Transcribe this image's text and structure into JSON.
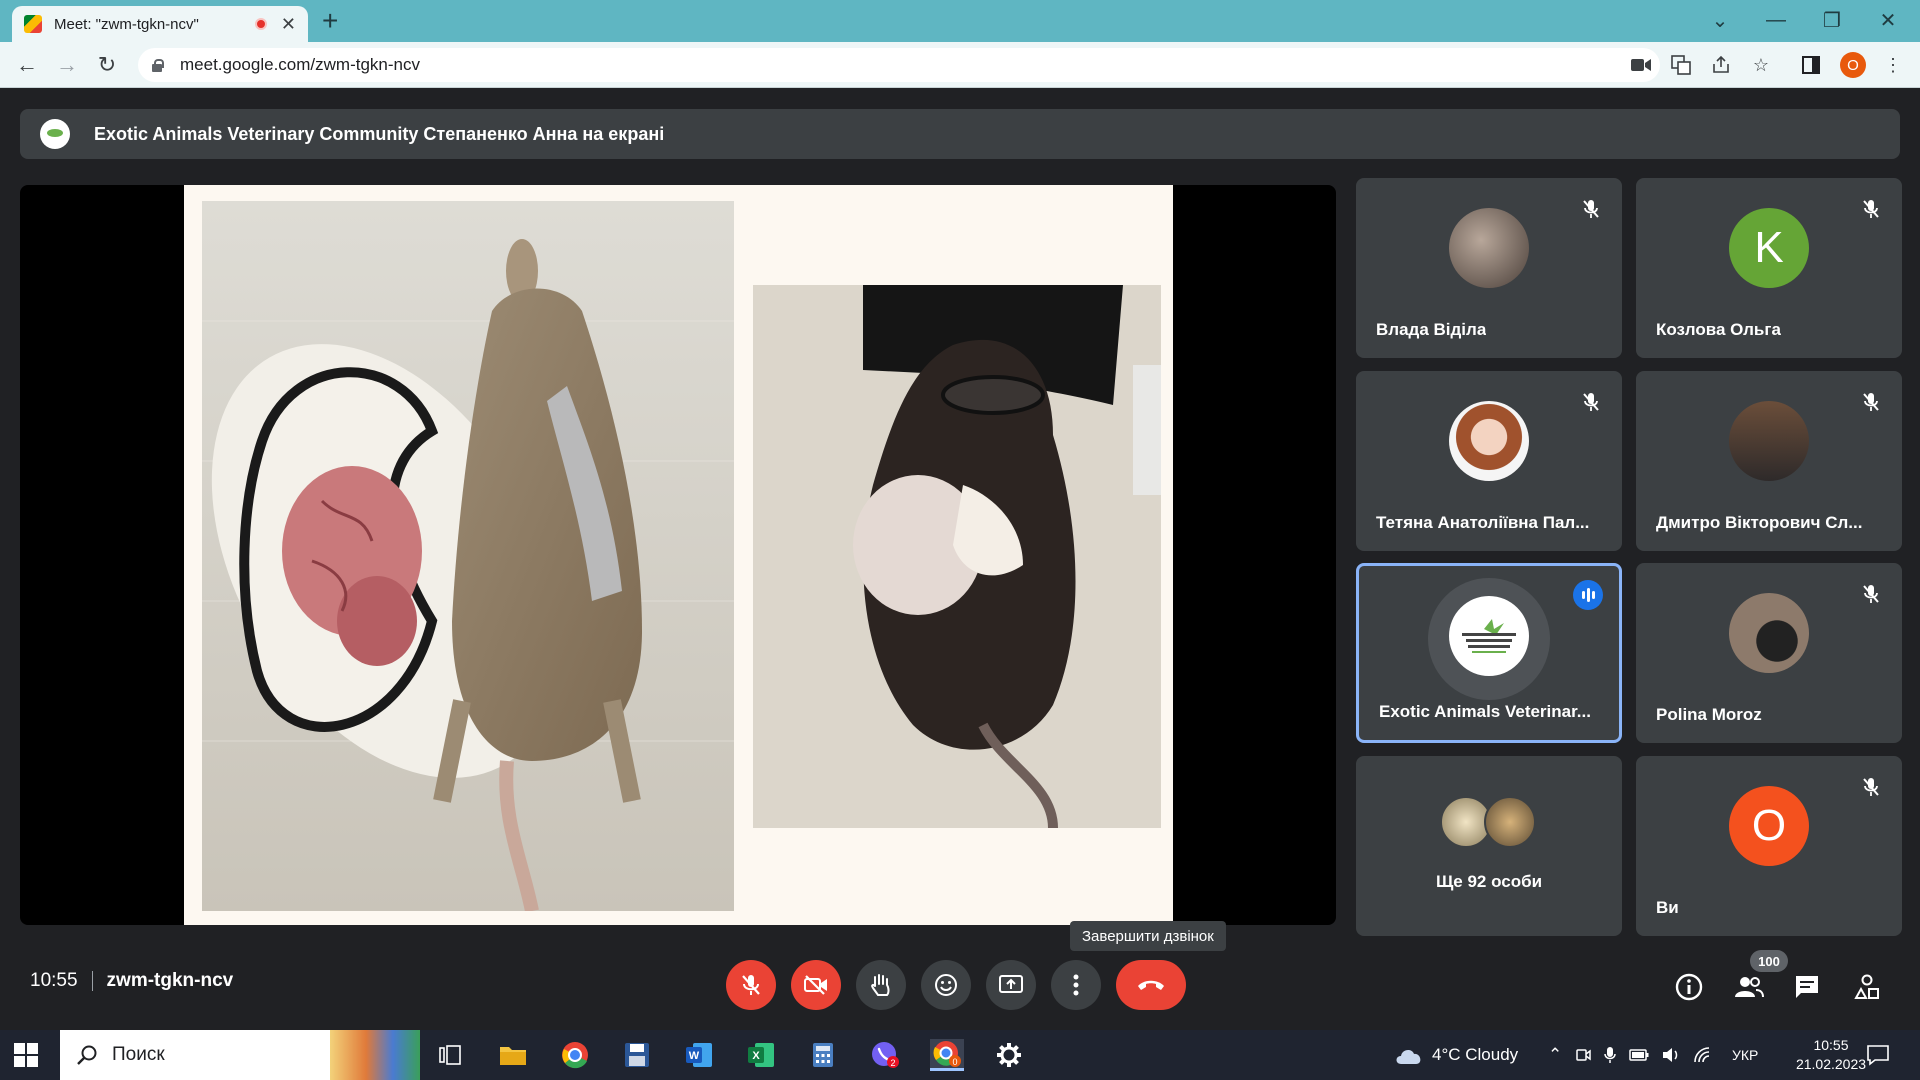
{
  "browser": {
    "tab_title": "Meet: \"zwm-tgkn-ncv\"",
    "url": "meet.google.com/zwm-tgkn-ncv",
    "profile_initial": "O"
  },
  "meet": {
    "banner_text": "Exotic Animals Veterinary Community Степаненко Анна на екрані",
    "participants": [
      {
        "name": "Влада Віділа",
        "avatar": "photo",
        "muted": true
      },
      {
        "name": "Козлова Ольга",
        "avatar_letter": "K",
        "avatar_color": "#65a536",
        "muted": true
      },
      {
        "name": "Тетяна Анатоліївна Пал...",
        "avatar": "photo",
        "muted": true
      },
      {
        "name": "Дмитро Вікторович Сл...",
        "avatar": "photo",
        "muted": true
      },
      {
        "name": "Exotic Animals Veterinar...",
        "avatar": "logo",
        "speaking": true
      },
      {
        "name": "Polina Moroz",
        "avatar": "photo",
        "muted": true
      },
      {
        "name": "Ще 92 особи",
        "avatar": "group"
      },
      {
        "name": "Ви",
        "avatar_letter": "О",
        "avatar_color": "#f4511e",
        "muted": true
      }
    ],
    "tooltip": "Завершити дзвінок",
    "time": "10:55",
    "meeting_code": "zwm-tgkn-ncv",
    "participants_count": "100"
  },
  "taskbar": {
    "search_placeholder": "Поиск",
    "weather": "4°C Cloudy",
    "language": "УКР",
    "time": "10:55",
    "date": "21.02.2023",
    "viber_badge": "2",
    "chrome_badge": "0"
  }
}
